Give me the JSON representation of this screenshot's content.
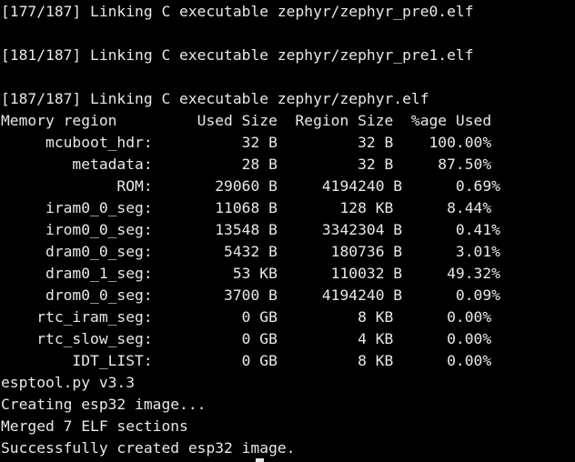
{
  "terminal": {
    "lines": [
      "[177/187] Linking C executable zephyr/zephyr_pre0.elf",
      "",
      "[181/187] Linking C executable zephyr/zephyr_pre1.elf",
      "",
      "[187/187] Linking C executable zephyr/zephyr.elf",
      "Memory region         Used Size  Region Size  %age Used",
      "     mcuboot_hdr:          32 B         32 B    100.00%",
      "        metadata:          28 B         32 B     87.50%",
      "             ROM:       29060 B     4194240 B      0.69%",
      "     iram0_0_seg:       11068 B       128 KB      8.44%",
      "     irom0_0_seg:       13548 B     3342304 B      0.41%",
      "     dram0_0_seg:        5432 B      180736 B      3.01%",
      "     dram0_1_seg:         53 KB      110032 B     49.32%",
      "     drom0_0_seg:        3700 B     4194240 B      0.09%",
      "    rtc_iram_seg:          0 GB         8 KB      0.00%",
      "    rtc_slow_seg:          0 GB         4 KB      0.00%",
      "        IDT_LIST:          0 GB         8 KB      0.00%",
      "esptool.py v3.3",
      "Creating esp32 image...",
      "Merged 7 ELF sections",
      "Successfully created esp32 image."
    ]
  }
}
